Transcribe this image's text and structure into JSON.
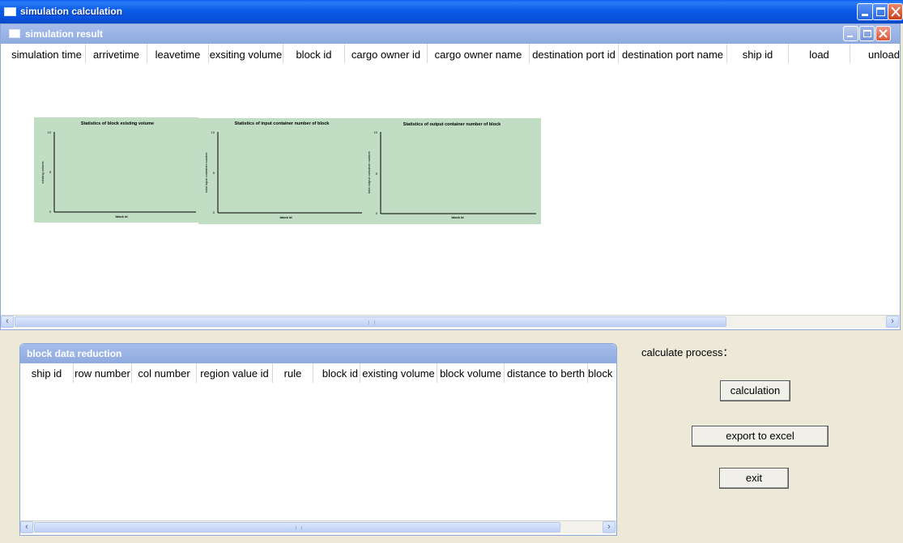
{
  "window": {
    "title": "simulation calculation"
  },
  "sim_result": {
    "title": "simulation result",
    "columns": [
      "simulation time",
      "arrivetime",
      "leavetime",
      "exsiting volume",
      "block id",
      "cargo owner id",
      "cargo owner name",
      "destination port id",
      "destination port name",
      "ship id",
      "load",
      "unload"
    ]
  },
  "charts": [
    {
      "title": "Statistics of block existing volume",
      "xlabel": "block id",
      "ylabel": "existing volume",
      "yticks": [
        "10",
        "5",
        "0"
      ]
    },
    {
      "title": "Statistics of input container number of block",
      "xlabel": "block id",
      "ylabel": "total input container number",
      "yticks": [
        "10",
        "5",
        "0"
      ]
    },
    {
      "title": "Statistics of output container number of block",
      "xlabel": "block id",
      "ylabel": "total output container number",
      "yticks": [
        "10",
        "5",
        "0"
      ]
    }
  ],
  "chart_data": [
    {
      "type": "line",
      "title": "Statistics of block existing volume",
      "xlabel": "block id",
      "ylabel": "existing volume",
      "ylim": [
        0,
        10
      ],
      "x": [],
      "series": []
    },
    {
      "type": "line",
      "title": "Statistics of input container number of block",
      "xlabel": "block id",
      "ylabel": "total input container number",
      "ylim": [
        0,
        10
      ],
      "x": [],
      "series": []
    },
    {
      "type": "line",
      "title": "Statistics of output container number of block",
      "xlabel": "block id",
      "ylabel": "total output container number",
      "ylim": [
        0,
        10
      ],
      "x": [],
      "series": []
    }
  ],
  "block_data": {
    "title": "block data reduction",
    "columns": [
      "ship id",
      "row number",
      "col number",
      "region value id",
      "rule",
      "block id",
      "existing volume",
      "block volume",
      "distance to berth",
      "block"
    ]
  },
  "process": {
    "label": "calculate process：",
    "calculation": "calculation",
    "export": "export to excel",
    "exit": "exit"
  }
}
